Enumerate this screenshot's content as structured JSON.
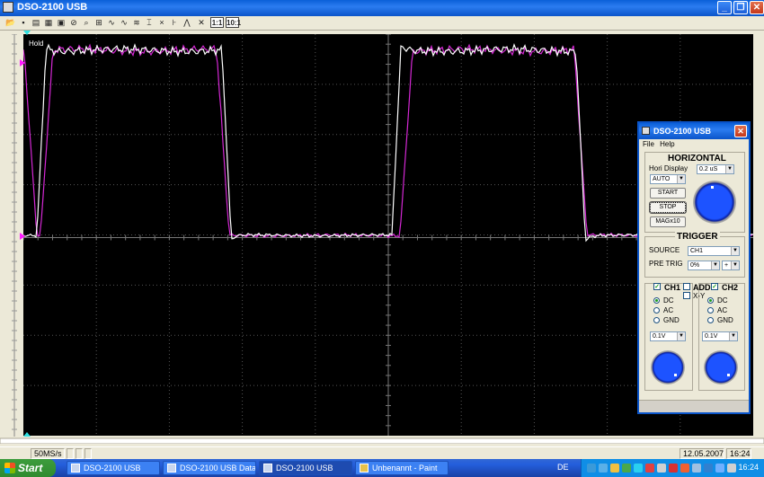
{
  "window": {
    "title": "DSO-2100 USB"
  },
  "scope": {
    "status_label": "Hold"
  },
  "statusbar": {
    "sample_rate": "50MS/s",
    "date": "12.05.2007",
    "time": "16:24"
  },
  "toolbar": {
    "btn_1_1": "1:1",
    "btn_10_1": "10:1"
  },
  "taskbar": {
    "start_label": "Start",
    "tasks": [
      {
        "label": "DSO-2100 USB"
      },
      {
        "label": "DSO-2100 USB Data"
      },
      {
        "label": "DSO-2100 USB"
      },
      {
        "label": "Unbenannt - Paint"
      }
    ],
    "language": "DE",
    "clock": "16:24"
  },
  "panel": {
    "title": "DSO-2100 USB",
    "menu": {
      "file": "File",
      "help": "Help"
    },
    "horizontal": {
      "header": "HORIZONTAL",
      "hori_display_label": "Hori Display",
      "hori_display_value": "AUTO",
      "timebase_value": "0.2 uS",
      "start_label": "START",
      "stop_label": "STOP",
      "mag_label": "MAGx10"
    },
    "trigger": {
      "header": "TRIGGER",
      "source_label": "SOURCE",
      "source_value": "CH1",
      "pretrig_label": "PRE TRIG",
      "pretrig_value": "0%",
      "slope_value": "+"
    },
    "channels": {
      "ch1_label": "CH1",
      "add_label": "ADD",
      "xy_label": "X-Y",
      "ch2_label": "CH2",
      "dc": "DC",
      "ac": "AC",
      "gnd": "GND",
      "ch1_volts": "0.1V",
      "ch2_volts": "0.1V"
    }
  }
}
